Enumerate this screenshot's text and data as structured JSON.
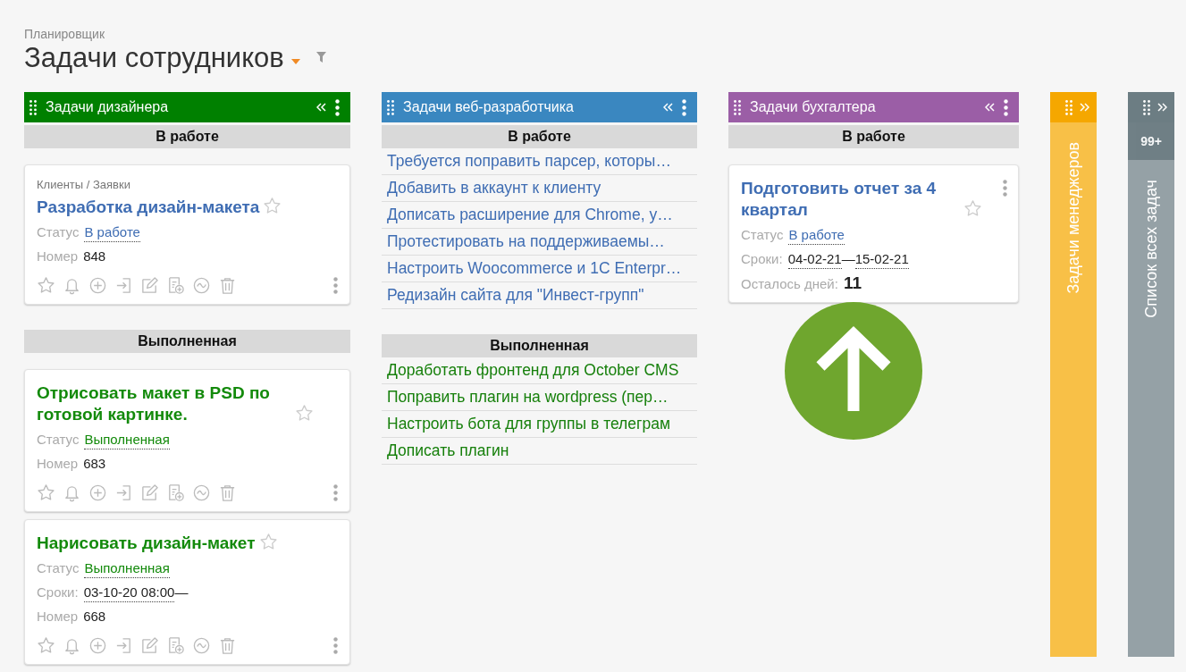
{
  "header": {
    "subtitle": "Планировщик",
    "title": "Задачи сотрудников"
  },
  "columns": [
    {
      "kind": "expanded",
      "title": "Задачи дизайнера",
      "color": "#008000",
      "groups": [
        {
          "title": "В работе",
          "kind": "cards",
          "items": [
            {
              "breadcrumb": "Клиенты / Заявки",
              "title": "Разработка дизайн-макета",
              "done": false,
              "toolbar": true,
              "fields": [
                {
                  "kind": "status",
                  "label": "Статус",
                  "value": "В работе"
                },
                {
                  "kind": "plain",
                  "label": "Номер",
                  "value": "848"
                }
              ]
            }
          ]
        },
        {
          "title": "Выполненная",
          "kind": "cards",
          "items": [
            {
              "title": "Отрисовать макет в PSD по готовой картинке.",
              "done": true,
              "toolbar": true,
              "fields": [
                {
                  "kind": "status",
                  "label": "Статус",
                  "value": "Выполненная"
                },
                {
                  "kind": "plain",
                  "label": "Номер",
                  "value": "683"
                }
              ]
            },
            {
              "title": "Нарисовать дизайн-макет",
              "done": true,
              "toolbar": true,
              "fields": [
                {
                  "kind": "status",
                  "label": "Статус",
                  "value": "Выполненная"
                },
                {
                  "kind": "dates",
                  "label": "Сроки:",
                  "start": "03-10-20 08:00",
                  "separator": "—"
                },
                {
                  "kind": "plain",
                  "label": "Номер",
                  "value": "668"
                }
              ]
            }
          ]
        }
      ]
    },
    {
      "kind": "expanded",
      "title": "Задачи веб-разработчика",
      "color": "#3a87c0",
      "groups": [
        {
          "title": "В работе",
          "kind": "list",
          "items": [
            {
              "title": "Требуется поправить парсер, которы…",
              "done": false
            },
            {
              "title": "Добавить в аккаунт к клиенту",
              "done": false
            },
            {
              "title": "Дописать расширение для Chrome, у…",
              "done": false
            },
            {
              "title": "Протестировать на поддерживаемы…",
              "done": false
            },
            {
              "title": "Настроить Woocommerce и 1C Enterpr…",
              "done": false
            },
            {
              "title": "Редизайн сайта для \"Инвест-групп\"",
              "done": false
            }
          ]
        },
        {
          "title": "Выполненная",
          "kind": "list",
          "items": [
            {
              "title": "Доработать фронтенд для October CMS",
              "done": true
            },
            {
              "title": "Поправить плагин на wordpress (пер…",
              "done": true
            },
            {
              "title": "Настроить бота для группы в телеграм",
              "done": true
            },
            {
              "title": "Дописать плагин",
              "done": true
            }
          ]
        }
      ]
    },
    {
      "kind": "expanded",
      "title": "Задачи бухгалтера",
      "color": "#9b5ea6",
      "groups": [
        {
          "title": "В работе",
          "kind": "cards",
          "items": [
            {
              "title": "Подготовить отчет за 4 квартал",
              "done": false,
              "toolbar": false,
              "fields": [
                {
                  "kind": "status",
                  "label": "Статус",
                  "value": "В работе"
                },
                {
                  "kind": "dates",
                  "label": "Сроки:",
                  "start": "04-02-21",
                  "separator": "—",
                  "end": "15-02-21"
                },
                {
                  "kind": "count",
                  "label": "Осталось дней:",
                  "value": "11"
                }
              ]
            }
          ]
        }
      ]
    },
    {
      "kind": "collapsed",
      "title": "Задачи менеджеров",
      "color": "#f5a700"
    },
    {
      "kind": "collapsed",
      "title": "Список всех задач",
      "color": "#6c7d83",
      "badge": "99+"
    }
  ]
}
